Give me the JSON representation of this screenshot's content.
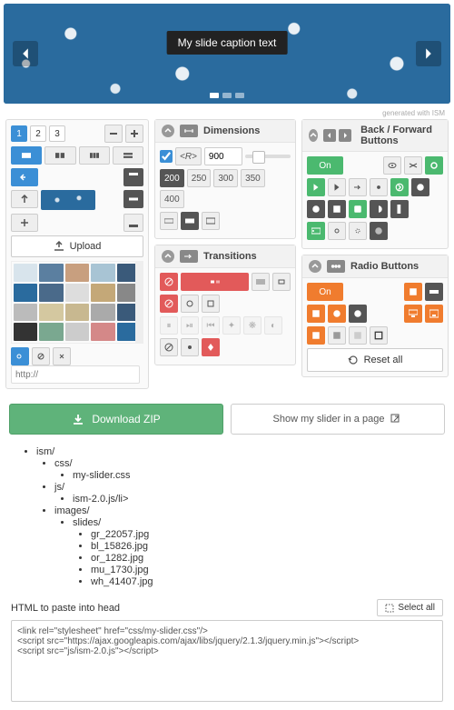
{
  "hero": {
    "caption": "My slide caption text",
    "generated": "generated with ISM"
  },
  "slides": {
    "numbers": [
      "1",
      "2",
      "3"
    ],
    "active": 0
  },
  "upload_label": "Upload",
  "url_placeholder": "http://",
  "dimensions": {
    "title": "Dimensions",
    "width_value": "900",
    "widths": [
      "200",
      "250",
      "300",
      "350",
      "400"
    ],
    "active_width": 0
  },
  "transitions": {
    "title": "Transitions"
  },
  "backforward": {
    "title": "Back / Forward Buttons",
    "toggle": "On"
  },
  "radiobuttons": {
    "title": "Radio Buttons",
    "toggle": "On",
    "reset": "Reset all"
  },
  "download_label": "Download ZIP",
  "show_label": "Show my slider in a page",
  "tree": {
    "root": "ism/",
    "css": "css/",
    "css_file": "my-slider.css",
    "js": "js/",
    "js_file": "ism-2.0.js/li>",
    "images": "images/",
    "slides": "slides/",
    "files": [
      "gr_22057.jpg",
      "bl_15826.jpg",
      "or_1282.jpg",
      "mu_1730.jpg",
      "wh_41407.jpg"
    ]
  },
  "paste": {
    "title": "HTML to paste into head",
    "select_all": "Select all",
    "code": "<link rel=\"stylesheet\" href=\"css/my-slider.css\"/>\n<script src=\"https://ajax.googleapis.com/ajax/libs/jquery/2.1.3/jquery.min.js\"></script>\n<script src=\"js/ism-2.0.js\"></script>"
  },
  "gallery_colors": [
    "#d8e4ec",
    "#5b7fa0",
    "#c89f7f",
    "#a8c4d4",
    "#3a5a7a",
    "#2a6b9e",
    "#4a6a8a",
    "#ddd",
    "#c4a878",
    "#888",
    "#bbb",
    "#d4c8a0",
    "#c8b890",
    "#aaa",
    "#3a5a7a",
    "#333",
    "#7aa890",
    "#ccc",
    "#d48888",
    "#2a6b9e"
  ]
}
